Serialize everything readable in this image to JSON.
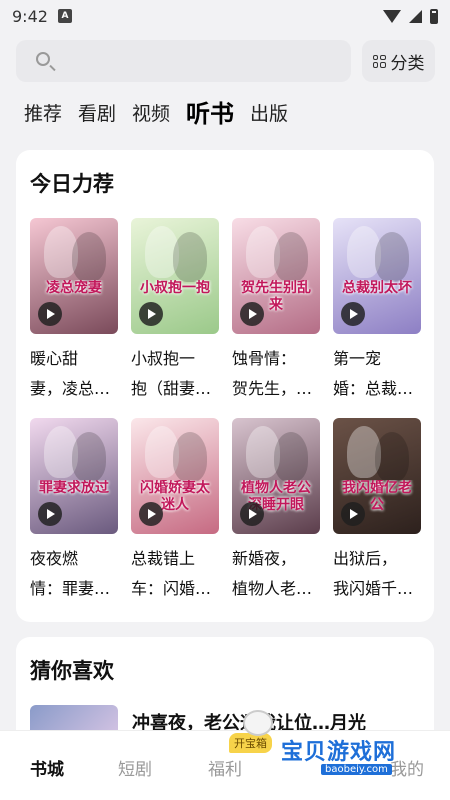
{
  "status_bar": {
    "time": "9:42",
    "notification_letter": "A"
  },
  "search": {
    "placeholder": "",
    "category_label": "分类"
  },
  "tabs": [
    {
      "label": "推荐",
      "active": false
    },
    {
      "label": "看剧",
      "active": false
    },
    {
      "label": "视频",
      "active": false
    },
    {
      "label": "听书",
      "active": true
    },
    {
      "label": "出版",
      "active": false
    }
  ],
  "today_picks": {
    "title": "今日力荐",
    "books": [
      {
        "line1": "暖心甜",
        "line2": "妻，凌总…",
        "cover_text": "凌总宠妻",
        "colors": [
          "#f5c7d3",
          "#7a4a5a"
        ]
      },
      {
        "line1": "小叔抱一",
        "line2": "抱（甜妻…",
        "cover_text": "小叔抱一抱",
        "colors": [
          "#e9f4d9",
          "#9bc98a"
        ]
      },
      {
        "line1": "蚀骨情：",
        "line2": "贺先生，…",
        "cover_text": "贺先生别乱来",
        "colors": [
          "#f8dde6",
          "#b46d86"
        ]
      },
      {
        "line1": "第一宠",
        "line2": "婚：总裁…",
        "cover_text": "总裁别太坏",
        "colors": [
          "#e6e2f7",
          "#8d7fc4"
        ]
      },
      {
        "line1": "夜夜燃",
        "line2": "情：罪妻…",
        "cover_text": "罪妻求放过",
        "colors": [
          "#f1d9ee",
          "#6a5a7e"
        ]
      },
      {
        "line1": "总裁错上",
        "line2": "车：闪婚…",
        "cover_text": "闪婚娇妻太迷人",
        "colors": [
          "#fbe7ea",
          "#c66a82"
        ]
      },
      {
        "line1": "新婚夜，",
        "line2": "植物人老…",
        "cover_text": "植物人老公深睡开眼",
        "colors": [
          "#d8c4cf",
          "#5b3d4b"
        ]
      },
      {
        "line1": "出狱后，",
        "line2": "我闪婚千…",
        "cover_text": "我闪婚亿老公",
        "colors": [
          "#6b5247",
          "#2d211d"
        ]
      }
    ]
  },
  "guess": {
    "title": "猜你喜欢",
    "first_title": "冲喜夜，老公逼我让位…月光"
  },
  "bottom_nav": {
    "items": [
      "书城",
      "短剧",
      "福利",
      "我的"
    ],
    "badge": "开宝箱"
  },
  "watermark": {
    "text": "宝贝游戏网",
    "url": "baobeiy.com"
  }
}
